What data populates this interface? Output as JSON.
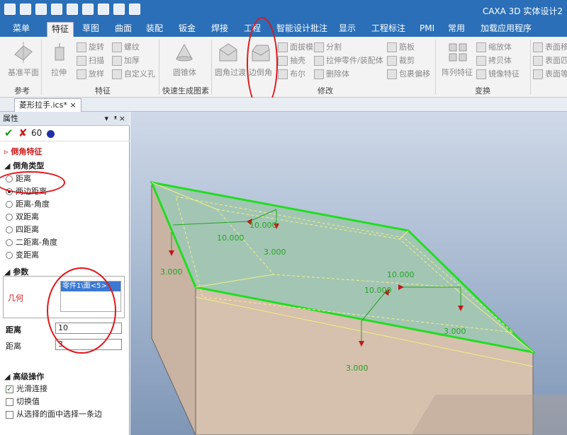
{
  "app": {
    "title": "CAXA 3D 实体设计2"
  },
  "menu": {
    "tabs": [
      "菜单",
      "特征",
      "草图",
      "曲面",
      "装配",
      "钣金",
      "焊接",
      "工程",
      "智能设计批注",
      "显示",
      "工程标注",
      "PMI",
      "常用",
      "加载应用程序"
    ],
    "active": "特征"
  },
  "ribbon": {
    "ref": {
      "button": "基准平面",
      "label": "参考"
    },
    "feature": {
      "big": "拉伸",
      "small": [
        "旋转",
        "扫描",
        "放样",
        "螺纹",
        "加厚",
        "自定义孔"
      ],
      "label": "特征"
    },
    "quick": {
      "button": "圆锥体",
      "label": "快速生成图素"
    },
    "modify": {
      "big1": "圆角过渡",
      "big2": "边倒角",
      "small": [
        "面拔模",
        "抽壳",
        "布尔",
        "分割",
        "拉伸零件/装配体",
        "删除体",
        "筋板",
        "裁剪",
        "包裹偏移"
      ],
      "label": "修改"
    },
    "transform": {
      "big": "阵列特征",
      "small": [
        "缩放体",
        "拷贝体",
        "镜像特征"
      ],
      "label": "变换"
    },
    "surface": {
      "small": [
        "表面移",
        "表面匹",
        "表面等"
      ]
    }
  },
  "doc": {
    "tab": "菱形拉手.ics*"
  },
  "panel": {
    "title": "属性",
    "pin": "ᵜ",
    "feature_title": "倒角特征",
    "type_title": "倒角类型",
    "options": [
      "距离",
      "两边距离",
      "距离-角度",
      "双距离",
      "四距离",
      "二距离-角度",
      "变距离"
    ],
    "selected": "两边距离",
    "params_title": "参数",
    "geom_label": "几何",
    "geom_item": "零件1\\面<5>",
    "dist1_label": "距离",
    "dist1_value": "10",
    "dist2_label": "距离",
    "dist2_value": "3",
    "adv_title": "高级操作",
    "adv": [
      {
        "label": "光滑连接",
        "checked": true
      },
      {
        "label": "切换值",
        "checked": false
      },
      {
        "label": "从选择的面中选择一条边",
        "checked": false
      }
    ]
  },
  "annotations": [
    "10.000",
    "3.000",
    "10.000",
    "10.000",
    "3.000",
    "3.000",
    "3.000",
    "10.000"
  ],
  "colors": {
    "accent": "#2a6fb8",
    "highlight": "#e0161b",
    "edge": "#22dd22"
  }
}
